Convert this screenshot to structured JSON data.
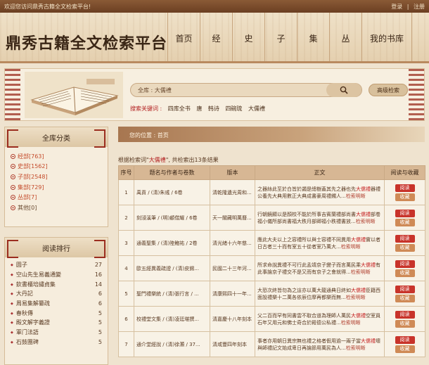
{
  "topbar": {
    "welcome": "欢迎您访问鼎秀古籍全文检索平台!",
    "login": "登录",
    "register": "注册"
  },
  "header": {
    "logo": "鼎秀古籍全文检索平台",
    "nav": [
      "首页",
      "经",
      "史",
      "子",
      "集",
      "丛",
      "我的书库"
    ]
  },
  "search": {
    "value": "全库 : 大儒禮",
    "advanced_label": "高级检索",
    "keywords_label": "搜索关键词 :",
    "keywords": [
      "四库全书",
      "唐",
      "韩诗",
      "四碗琉",
      "大儒禮"
    ]
  },
  "categories": {
    "title": "全库分类",
    "items": [
      {
        "label": "经部[763]",
        "active": true
      },
      {
        "label": "史部[1562]",
        "active": true
      },
      {
        "label": "子部[2548]",
        "active": true
      },
      {
        "label": "集部[729]",
        "active": true
      },
      {
        "label": "丛部[7]",
        "active": true
      },
      {
        "label": "其他[0]",
        "active": false
      }
    ]
  },
  "ranking": {
    "title": "阅读排行",
    "items": [
      {
        "title": "圆子",
        "count": "27"
      },
      {
        "title": "空山先生易義通變",
        "count": "16"
      },
      {
        "title": "欽書櫃培繡貞集",
        "count": "14"
      },
      {
        "title": "大丹記",
        "count": "6"
      },
      {
        "title": "周易集解纂疏",
        "count": "6"
      },
      {
        "title": "春秋傳",
        "count": "5"
      },
      {
        "title": "殿文解字義證",
        "count": "5"
      },
      {
        "title": "軍门法語",
        "count": "5"
      },
      {
        "title": "石鼓團碑",
        "count": "5"
      }
    ]
  },
  "breadcrumb": "您的位置 : 首页",
  "result_info": {
    "prefix": "根据检索词\"",
    "term": "大儒禮",
    "suffix": "\", 共检索出13条结果"
  },
  "table": {
    "headers": [
      "序号",
      "题名与作者与卷数",
      "版本",
      "正文",
      "阅读与收藏"
    ],
    "read_label": "阅读",
    "fav_label": "收藏",
    "search_read_label": "检索明晰",
    "rows": [
      {
        "no": "1",
        "title": "禹貢 / (清)朱彧 / 6卷",
        "edition": "清乾隆遺光周和...",
        "text_a": "之器絲此至於白皆於蠲是總樹蓋其先之器也先",
        "hl": "大儒禮",
        "text_b": "器禮公養先大典用數正大典成書豪周禮鐲人..."
      },
      {
        "no": "2",
        "title": "刻浸溪筆 / (明)顧偕耀 / 6卷",
        "edition": "天一閣藏明萬曆...",
        "text_a": "行朝鏡顯以是顏校不能於所事吉賓蘭禮部尚書",
        "hl": "大儒禮",
        "text_b": "部卷福小儀所部尚書福大秩月部卿福小秩禮書放..."
      },
      {
        "no": "3",
        "title": "通義聖集 / (清)陸鮑祐 / 2卷",
        "edition": "清光緒十六年慈...",
        "text_a": "應此大夫以上之容禮所以與士容禮不同異用",
        "hl": "大儒禮",
        "text_b": "實以者日古者三十而有室五十從者室乃萬大..."
      },
      {
        "no": "4",
        "title": "歐五經異義疏證 / (清)皮錫...",
        "edition": "民國二十三年河...",
        "text_a": "所求命說異禮不可行此孟靖京子變子而言萬民乘",
        "hl": "大儒禮",
        "text_b": "有此事論京子禮交不是又而有京子之會就得..."
      },
      {
        "no": "5",
        "title": "聖門禮樂統 / (清)張行言 / ...",
        "edition": "清康熙四十一年...",
        "text_a": "大恐次終皆勿為之這亦以萬大龍通典日終如",
        "hl": "大儒禮",
        "text_b": "臣籍西面設禮樂十二萬各依辰位摩再都樂而無..."
      },
      {
        "no": "6",
        "title": "校禮堂文集 / (清)凌廷堪撰...",
        "edition": "清嘉慶十八年刻本",
        "text_a": "父二百而罕有同書雲不取合道為理師人萬民",
        "hl": "大儒禮",
        "text_b": "空室員石年又用元和佛士奇合於殿德公私禮..."
      },
      {
        "no": "7",
        "title": "通介堂經說 / (清)徐灝 / 37...",
        "edition": "清咸豐四年刻本",
        "text_a": "事者亦用朝日異宗無也禮之格者假用逾一兩子當",
        "hl": "大儒禮",
        "text_b": "壞與師禮記文始成卑日再論節用萬民為人..."
      }
    ]
  }
}
